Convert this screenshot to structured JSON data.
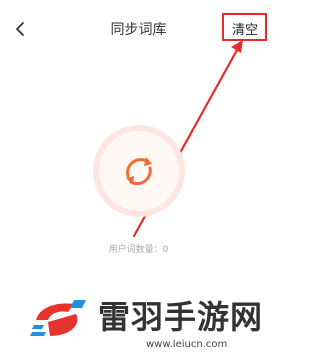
{
  "header": {
    "back_icon": "chevron-left-icon",
    "title": "同步词库",
    "clear_label": "清空"
  },
  "main": {
    "sync_icon": "sync-icon",
    "user_word_count_label": "用户词数量：0"
  },
  "annotation": {
    "color": "#e52b2b"
  },
  "watermark": {
    "text": "雷羽手游网",
    "url": "www.leiucn.com"
  },
  "colors": {
    "accent": "#f06a3a",
    "ring": "#fde6df"
  }
}
